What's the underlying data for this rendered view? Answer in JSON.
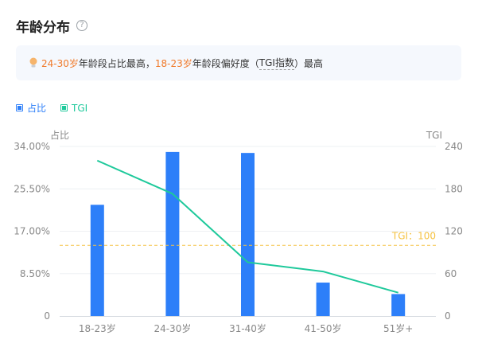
{
  "header": {
    "title": "年龄分布",
    "help_icon": "question-circle-icon"
  },
  "insight": {
    "icon": "lightbulb-icon",
    "age_peak": "24-30岁",
    "text_mid": "年龄段占比最高，",
    "age_pref": "18-23岁",
    "text_end_pre": "年龄段偏好度（",
    "tgi_term": "TGI指数",
    "text_end_post": "）最高"
  },
  "colors": {
    "bar": "#2d7ff9",
    "line": "#1ec99b",
    "ref": "#f5c242",
    "highlight": "#f07a2a",
    "grid": "#eef0f3"
  },
  "chart_data": {
    "type": "bar+line",
    "categories": [
      "18-23岁",
      "24-30岁",
      "31-40岁",
      "41-50岁",
      "51岁+"
    ],
    "series": [
      {
        "name": "占比",
        "type": "bar",
        "axis": "left",
        "values": [
          22.3,
          32.9,
          32.7,
          6.7,
          4.4
        ]
      },
      {
        "name": "TGI",
        "type": "line",
        "axis": "right",
        "values": [
          220,
          173,
          76,
          63,
          33
        ]
      }
    ],
    "left_axis": {
      "title": "占比",
      "min": 0,
      "max": 34,
      "ticks": [
        "0",
        "8.50%",
        "17.00%",
        "25.50%",
        "34.00%"
      ]
    },
    "right_axis": {
      "title": "TGI",
      "min": 0,
      "max": 240,
      "ticks": [
        "0",
        "60",
        "120",
        "180",
        "240"
      ]
    },
    "reference_line": {
      "value": 100,
      "label": "TGI：100"
    },
    "legend": [
      "占比",
      "TGI"
    ]
  }
}
